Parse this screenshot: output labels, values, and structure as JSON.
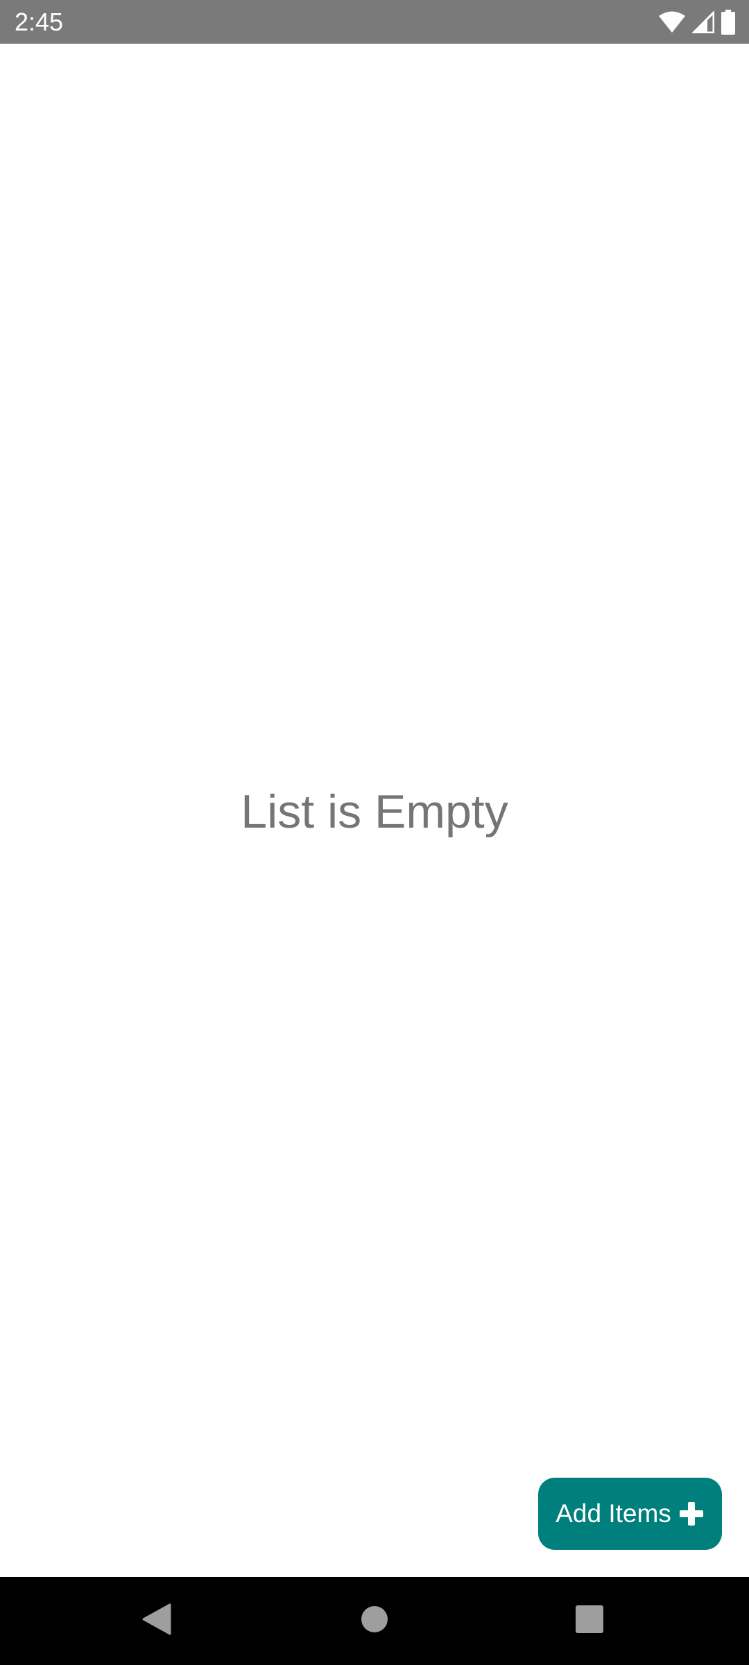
{
  "status_bar": {
    "time": "2:45",
    "icons": [
      "wifi-icon",
      "cellular-signal-icon",
      "battery-icon"
    ]
  },
  "main": {
    "empty_message": "List is Empty"
  },
  "add_button": {
    "label": "Add Items",
    "icon": "plus-icon",
    "color": "#00807d"
  },
  "nav_bar": {
    "buttons": [
      "back-icon",
      "home-icon",
      "recents-icon"
    ]
  },
  "colors": {
    "status_bar_bg": "#7a7a7a",
    "nav_bar_bg": "#000000",
    "empty_text": "#757575",
    "accent": "#00807d"
  }
}
